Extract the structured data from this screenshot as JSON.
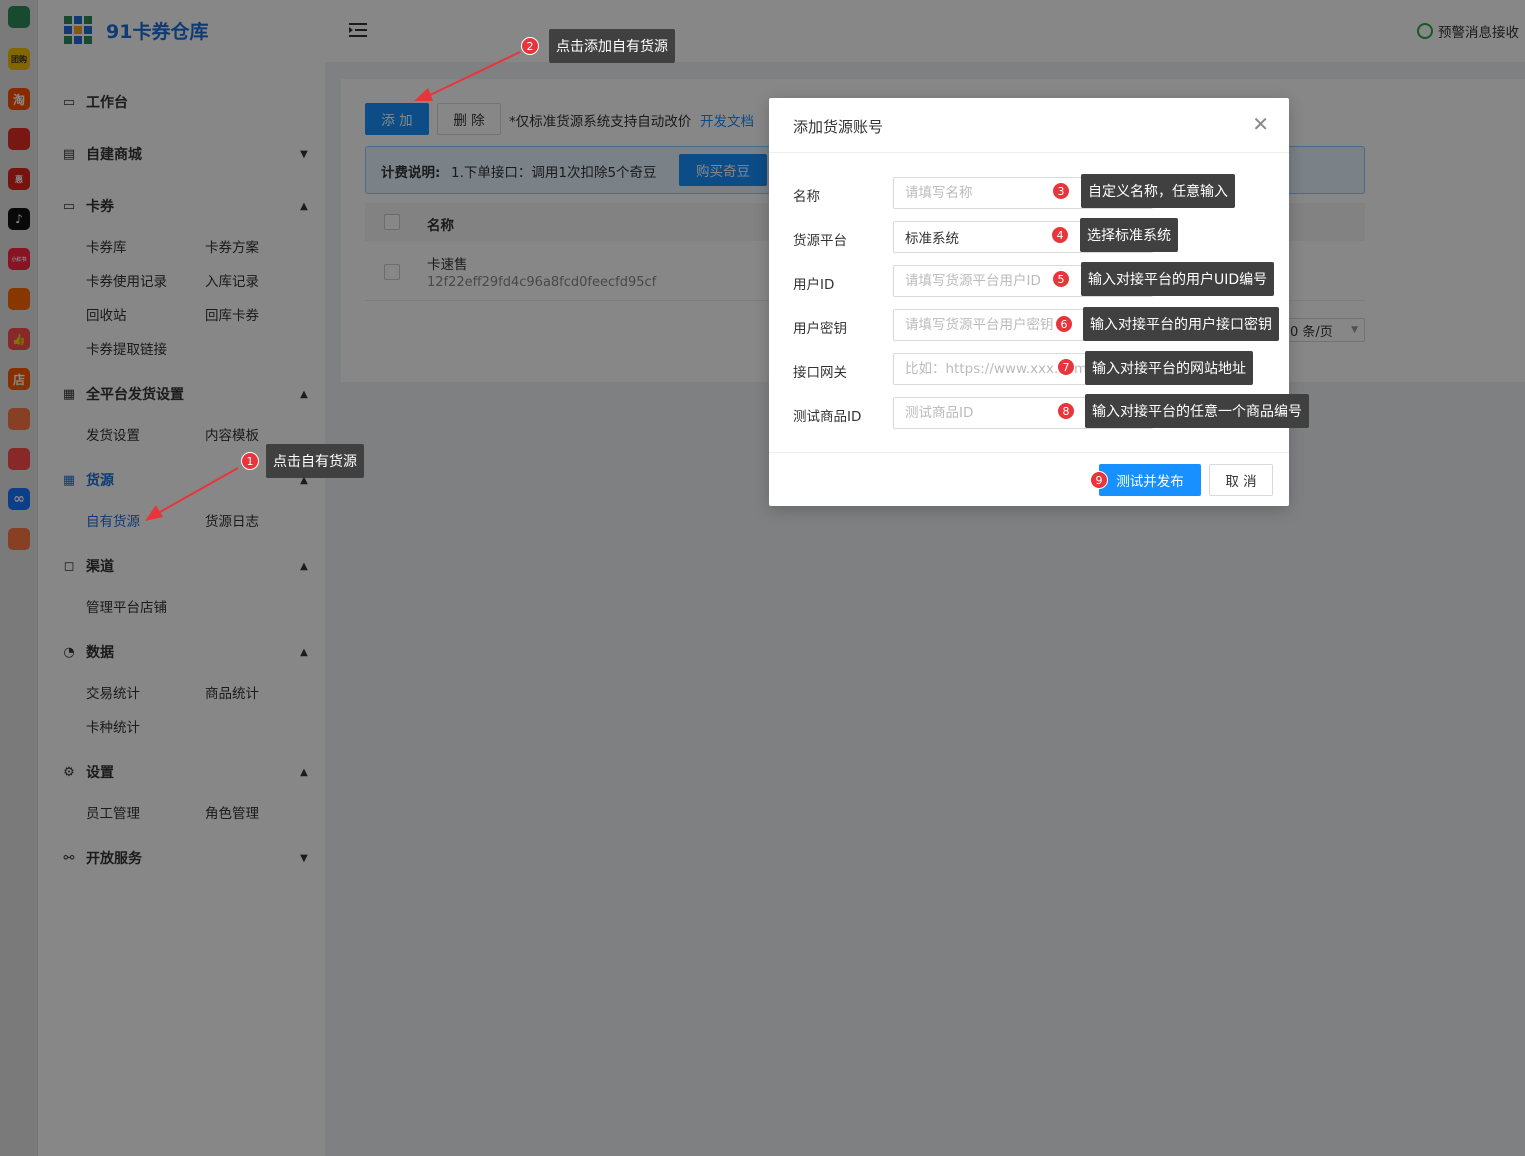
{
  "app_strip": {
    "icons": [
      {
        "name": "grid-logo-icon",
        "color": "#2d8c5a",
        "text": ""
      },
      {
        "name": "tuangou-icon",
        "color": "#f5c000",
        "text": "团购"
      },
      {
        "name": "taobao-icon",
        "color": "#ff5000",
        "text": "淘"
      },
      {
        "name": "pinduoduo-icon",
        "color": "#e02e24",
        "text": ""
      },
      {
        "name": "jingdong-icon",
        "color": "#e1251b",
        "text": "惠"
      },
      {
        "name": "douyin-icon",
        "color": "#111111",
        "text": "♪"
      },
      {
        "name": "xiaohongshu-icon",
        "color": "#ff2442",
        "text": "小红书"
      },
      {
        "name": "meituan-icon",
        "color": "#ff6b00",
        "text": ""
      },
      {
        "name": "like-icon",
        "color": "#ff4d4f",
        "text": "👍"
      },
      {
        "name": "shop-icon",
        "color": "#ff5a00",
        "text": "店"
      },
      {
        "name": "gift-icon",
        "color": "#ff7a45",
        "text": ""
      },
      {
        "name": "clipboard-icon",
        "color": "#ff4d4f",
        "text": ""
      },
      {
        "name": "link-icon",
        "color": "#1677ff",
        "text": "∞"
      },
      {
        "name": "coupon-icon",
        "color": "#ff7a45",
        "text": ""
      }
    ]
  },
  "sidebar": {
    "title": "91卡券仓库",
    "groups": [
      {
        "label": "工作台",
        "icon": "monitor-icon",
        "chevron": ""
      },
      {
        "label": "自建商城",
        "icon": "store-icon",
        "chevron": "down"
      },
      {
        "label": "卡券",
        "icon": "card-icon",
        "chevron": "up"
      },
      {
        "label": "全平台发货设置",
        "icon": "grid-icon",
        "chevron": "up"
      },
      {
        "label": "货源",
        "icon": "table-icon",
        "chevron": "up"
      },
      {
        "label": "渠道",
        "icon": "bag-icon",
        "chevron": "up"
      },
      {
        "label": "数据",
        "icon": "pie-chart-icon",
        "chevron": "up"
      },
      {
        "label": "设置",
        "icon": "gear-icon",
        "chevron": "up"
      },
      {
        "label": "开放服务",
        "icon": "link-icon",
        "chevron": "down"
      }
    ],
    "sub": {
      "card_library": "卡券库",
      "card_plan": "卡券方案",
      "card_usage": "卡券使用记录",
      "inbound_record": "入库记录",
      "recycle_bin": "回收站",
      "return_card": "回库卡券",
      "card_link": "卡券提取链接",
      "ship_settings": "发货设置",
      "content_template": "内容模板",
      "own_source": "自有货源",
      "source_log": "货源日志",
      "manage_shops": "管理平台店铺",
      "trade_stats": "交易统计",
      "product_stats": "商品统计",
      "card_type_stats": "卡种统计",
      "staff": "员工管理",
      "roles": "角色管理"
    }
  },
  "topbar": {
    "warning_label": "预警消息接收"
  },
  "toolbar": {
    "add_label": "添 加",
    "delete_label": "删 除",
    "note": "*仅标准货源系统支持自动改价",
    "doc_link": "开发文档"
  },
  "notice": {
    "title": "计费说明:",
    "text": "1.下单接口：调用1次扣除5个奇豆",
    "buy_button": "购买奇豆"
  },
  "table": {
    "col_name": "名称",
    "rows": [
      {
        "name": "卡速售",
        "id": "12f22eff29fd4c96a8fcd0feecfd95cf"
      }
    ],
    "page_size": "0 条/页"
  },
  "modal": {
    "title": "添加货源账号",
    "fields": [
      {
        "label": "名称",
        "value": "",
        "placeholder": "请填写名称"
      },
      {
        "label": "货源平台",
        "value": "标准系统",
        "placeholder": ""
      },
      {
        "label": "用户ID",
        "value": "",
        "placeholder": "请填写货源平台用户ID"
      },
      {
        "label": "用户密钥",
        "value": "",
        "placeholder": "请填写货源平台用户密钥"
      },
      {
        "label": "接口网关",
        "value": "",
        "placeholder": "比如：https://www.xxx.com"
      },
      {
        "label": "测试商品ID",
        "value": "",
        "placeholder": "测试商品ID"
      }
    ],
    "submit_label": "测试并发布",
    "cancel_label": "取 消"
  },
  "annotations": [
    {
      "num": "1",
      "text": "点击自有货源"
    },
    {
      "num": "2",
      "text": "点击添加自有货源"
    },
    {
      "num": "3",
      "text": "自定义名称，任意输入"
    },
    {
      "num": "4",
      "text": "选择标准系统"
    },
    {
      "num": "5",
      "text": "输入对接平台的用户UID编号"
    },
    {
      "num": "6",
      "text": "输入对接平台的用户接口密钥"
    },
    {
      "num": "7",
      "text": "输入对接平台的网站地址"
    },
    {
      "num": "8",
      "text": "输入对接平台的任意一个商品编号"
    },
    {
      "num": "9",
      "text": ""
    }
  ],
  "colors": {
    "primary": "#1890ff",
    "brand": "#1e6fd9",
    "annotation_badge": "#e8353b",
    "arrow": "#e8353b"
  }
}
